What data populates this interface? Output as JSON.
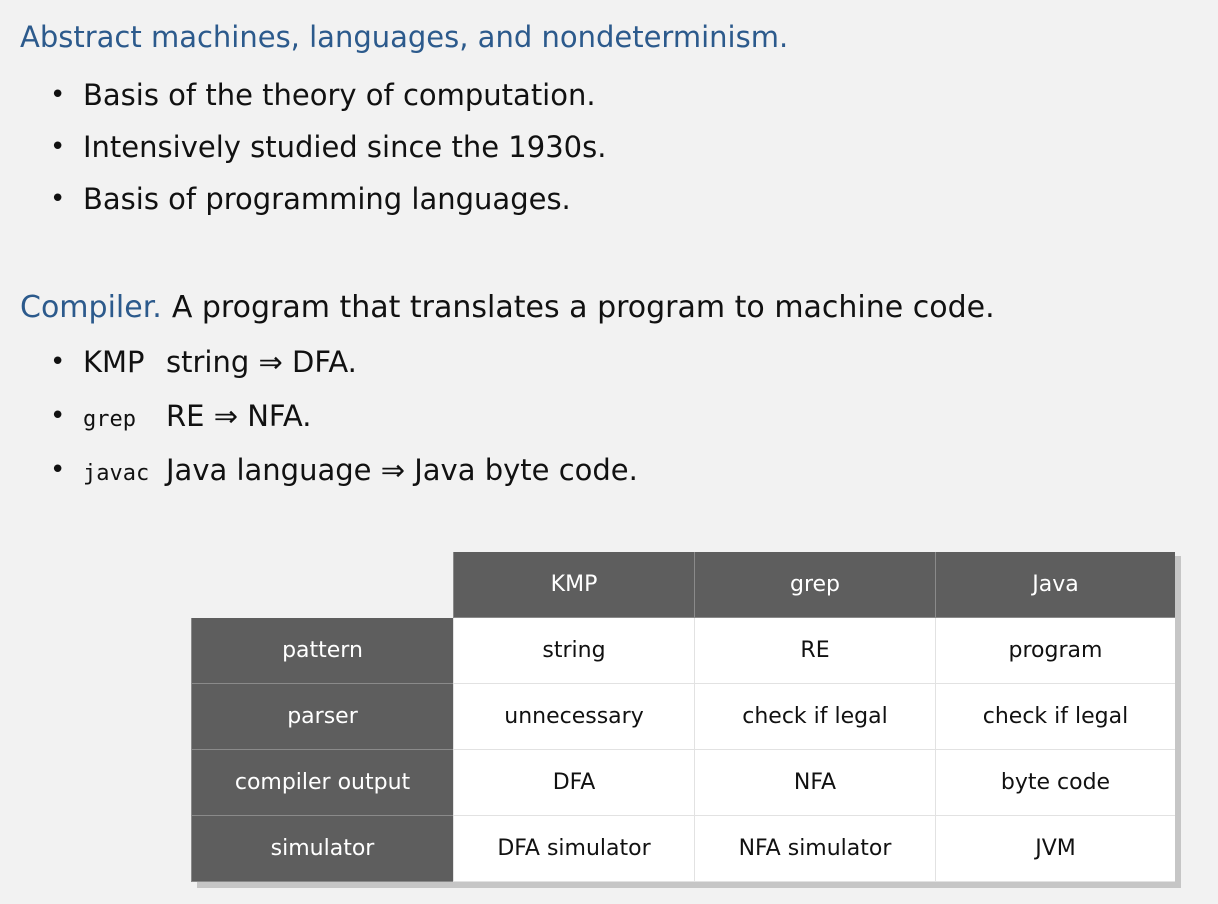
{
  "heading1": "Abstract machines, languages, and nondeterminism.",
  "bullets1": [
    "Basis of the theory of computation.",
    "Intensively studied since the 1930s.",
    "Basis of programming languages."
  ],
  "heading2": {
    "label": "Compiler.",
    "text": "A program that translates a program to machine code."
  },
  "bullets2": [
    {
      "tag": "KMP",
      "text": "string ⇒ DFA."
    },
    {
      "tag": "grep",
      "text": "RE ⇒ NFA."
    },
    {
      "tag": "javac",
      "text": "Java language ⇒ Java byte code."
    }
  ],
  "table": {
    "columns": [
      "KMP",
      "grep",
      "Java"
    ],
    "rows": [
      {
        "label": "pattern",
        "cells": [
          "string",
          "RE",
          "program"
        ]
      },
      {
        "label": "parser",
        "cells": [
          "unnecessary",
          "check if legal",
          "check if legal"
        ]
      },
      {
        "label": "compiler output",
        "cells": [
          "DFA",
          "NFA",
          "byte code"
        ]
      },
      {
        "label": "simulator",
        "cells": [
          "DFA simulator",
          "NFA simulator",
          "JVM"
        ]
      }
    ]
  }
}
